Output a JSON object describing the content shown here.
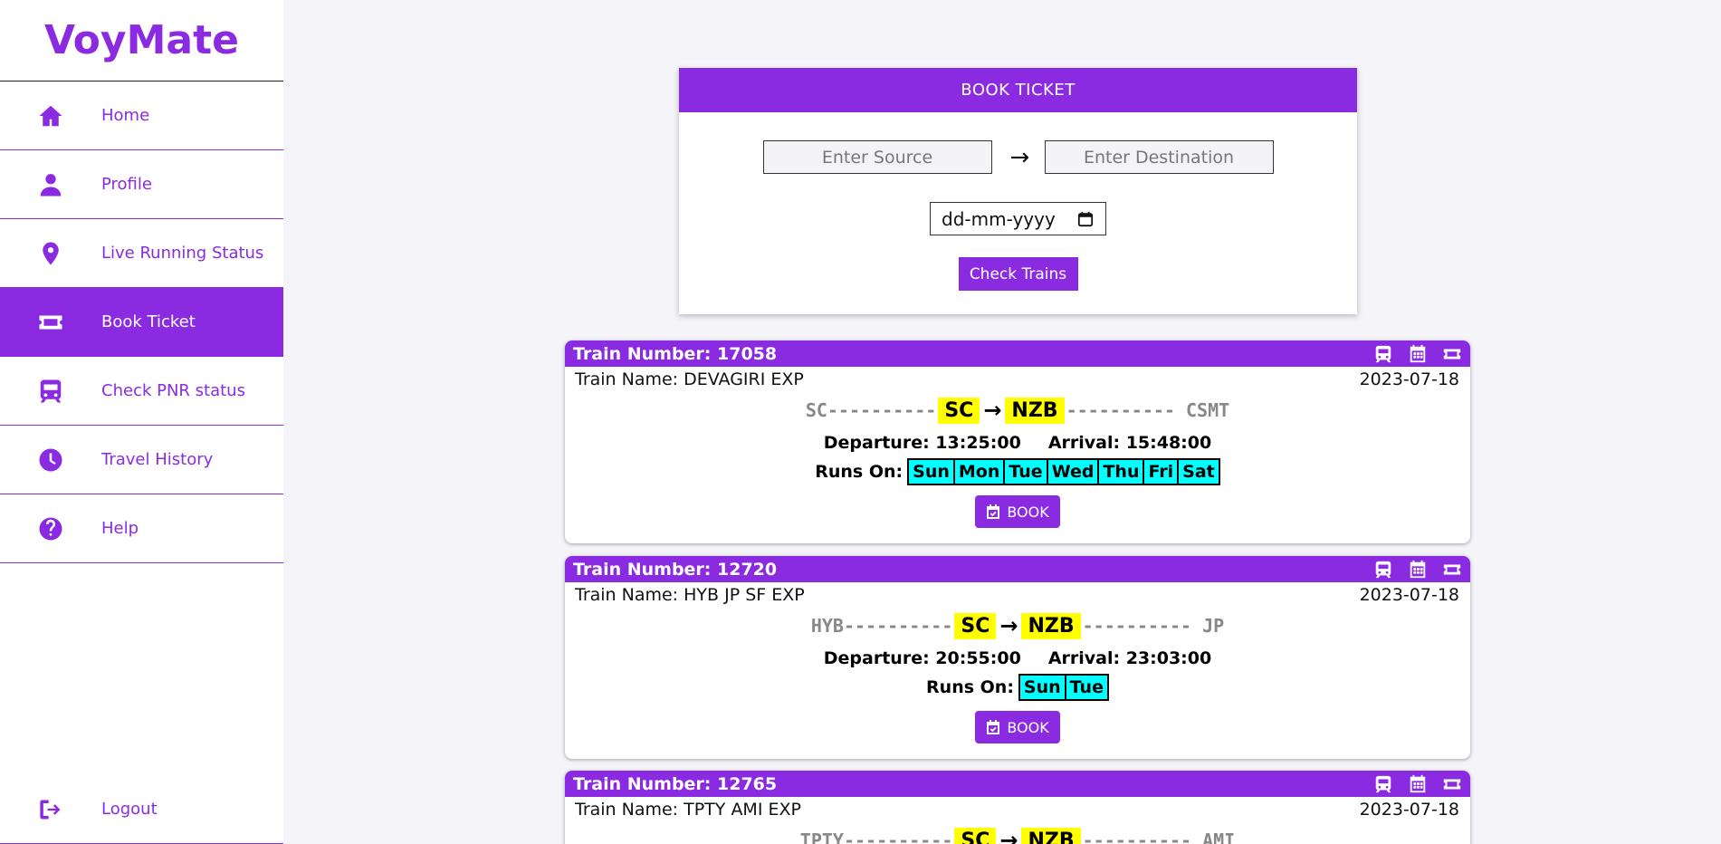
{
  "brand": "VoyMate",
  "sidebar": {
    "items": [
      {
        "label": "Home"
      },
      {
        "label": "Profile"
      },
      {
        "label": "Live Running Status"
      },
      {
        "label": "Book Ticket"
      },
      {
        "label": "Check PNR status"
      },
      {
        "label": "Travel History"
      },
      {
        "label": "Help"
      }
    ],
    "logout": "Logout",
    "active_item": "Book Ticket"
  },
  "book_ticket": {
    "title": "BOOK TICKET",
    "source_placeholder": "Enter Source",
    "destination_placeholder": "Enter Destination",
    "date_placeholder": "dd-mm-yyyy",
    "check_button": "Check Trains"
  },
  "trains": [
    {
      "number": "Train Number: 17058",
      "name": "Train Name: DEVAGIRI EXP",
      "date": "2023-07-18",
      "origin": "SC----------",
      "from": "SC",
      "to": "NZB",
      "terminus": "---------- CSMT",
      "departure": "Departure: 13:25:00",
      "arrival": "Arrival: 15:48:00",
      "runs_label": "Runs On:",
      "days": [
        "Sun",
        "Mon",
        "Tue",
        "Wed",
        "Thu",
        "Fri",
        "Sat"
      ],
      "book_label": "BOOK"
    },
    {
      "number": "Train Number: 12720",
      "name": "Train Name: HYB JP SF EXP",
      "date": "2023-07-18",
      "origin": "HYB----------",
      "from": "SC",
      "to": "NZB",
      "terminus": "---------- JP",
      "departure": "Departure: 20:55:00",
      "arrival": "Arrival: 23:03:00",
      "runs_label": "Runs On:",
      "days": [
        "Sun",
        "Tue"
      ],
      "book_label": "BOOK"
    },
    {
      "number": "Train Number: 12765",
      "name": "Train Name: TPTY AMI EXP",
      "date": "2023-07-18",
      "origin": "TPTY----------",
      "from": "SC",
      "to": "NZB",
      "terminus": "---------- AMI"
    }
  ],
  "colors": {
    "accent": "#8a2be2",
    "station_highlight": "#ffff00",
    "day_highlight": "#00ffff",
    "background": "#f4f4f9"
  }
}
